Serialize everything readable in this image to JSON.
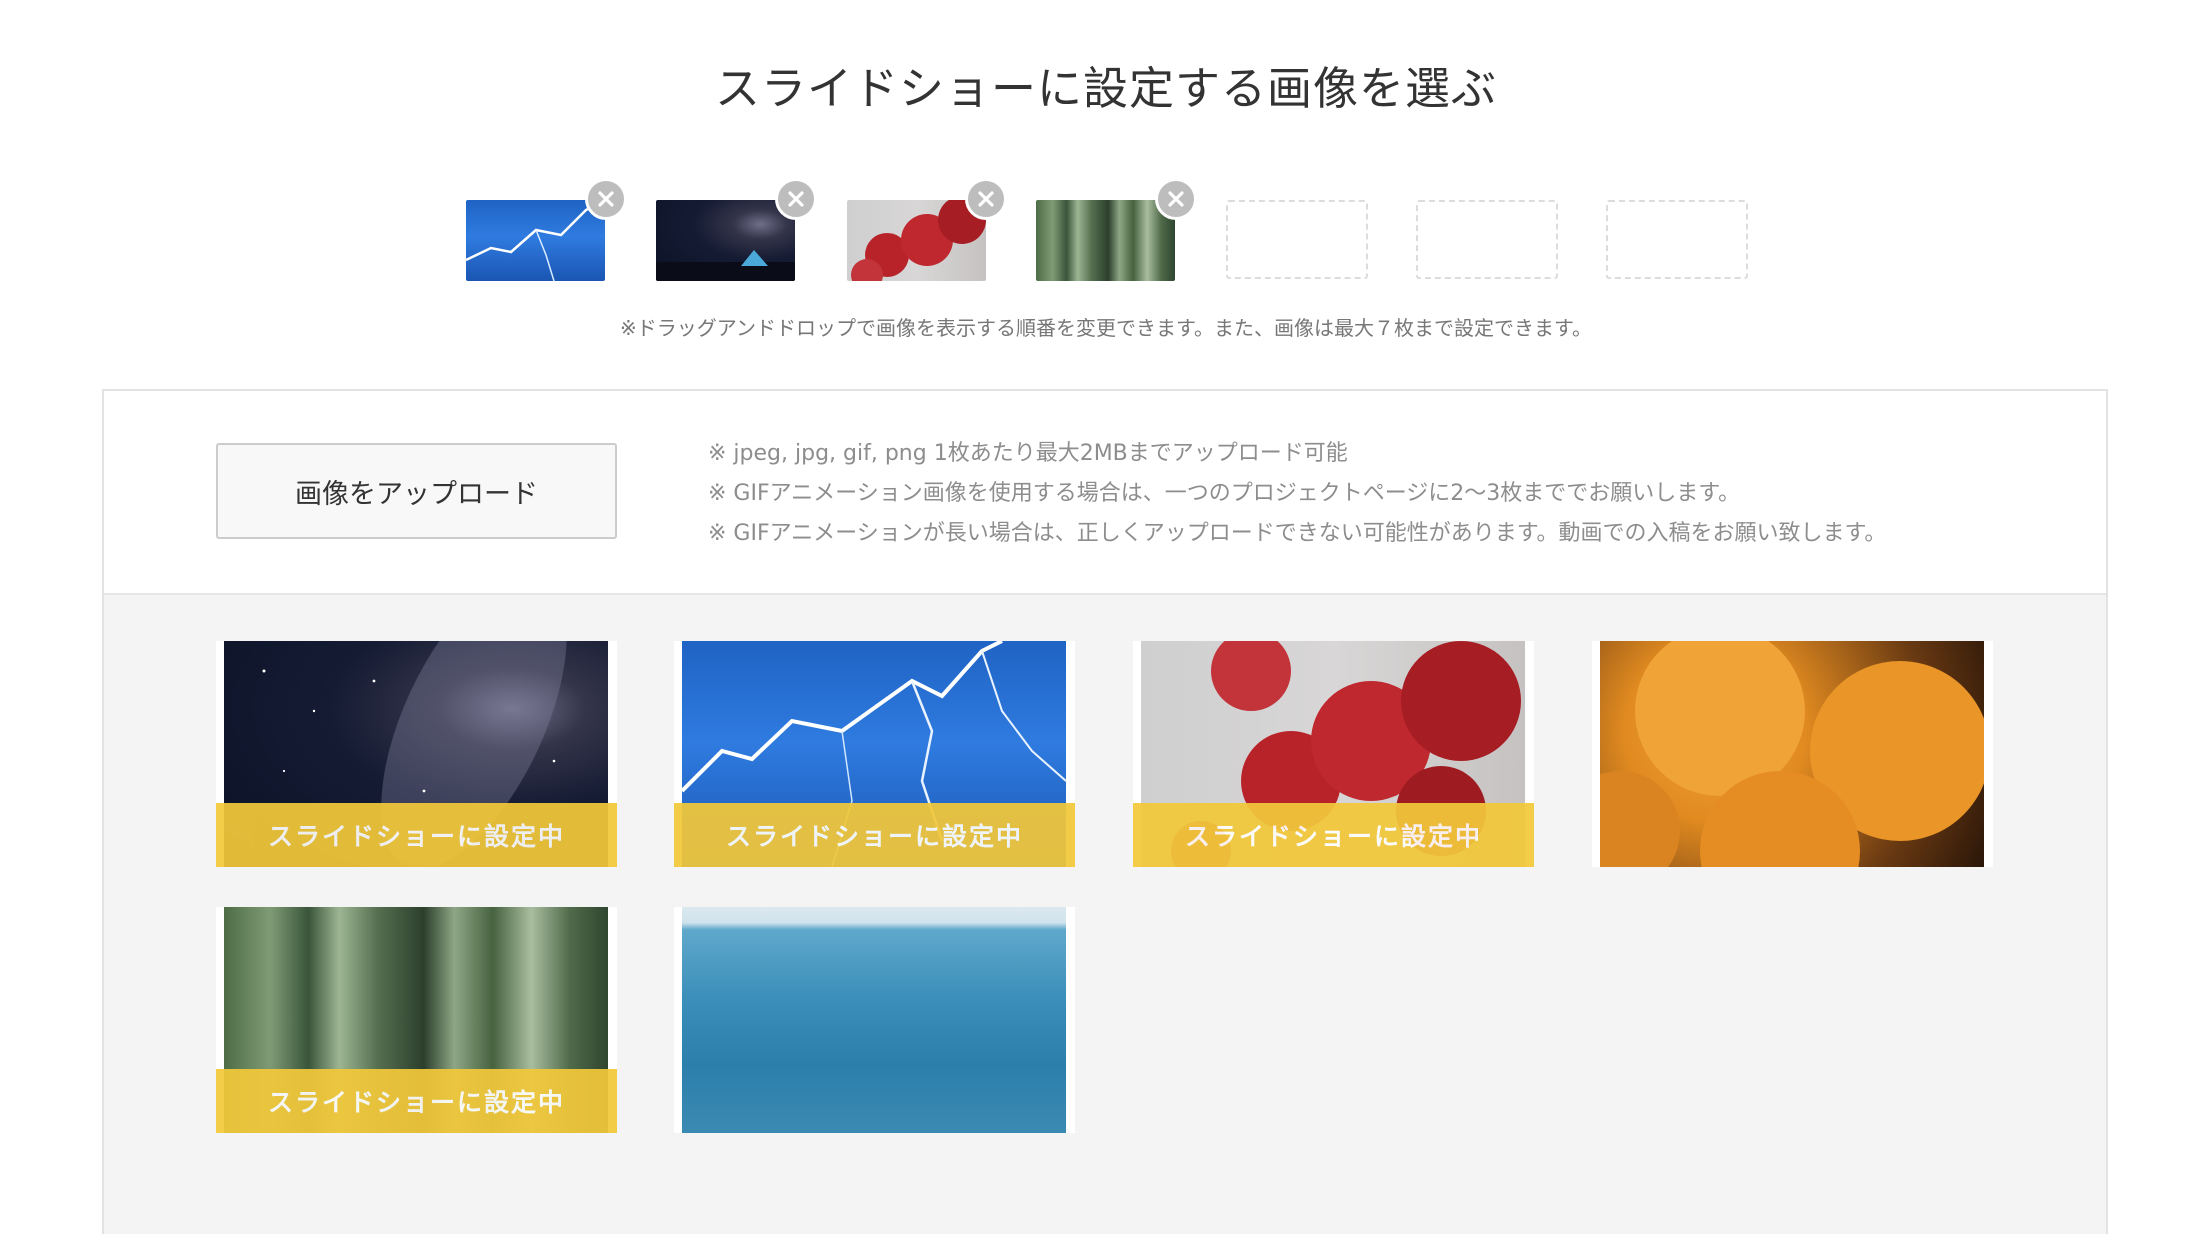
{
  "header": {
    "title": "スライドショーに設定する画像を選ぶ"
  },
  "selected": {
    "images": [
      {
        "name": "lightning",
        "remove_icon": "close-icon"
      },
      {
        "name": "starry-tent",
        "remove_icon": "close-icon"
      },
      {
        "name": "red-maple",
        "remove_icon": "close-icon"
      },
      {
        "name": "bamboo",
        "remove_icon": "close-icon"
      }
    ],
    "empty_slots": 3,
    "note": "※ドラッグアンドドロップで画像を表示する順番を変更できます。また、画像は最大７枚まで設定できます。"
  },
  "upload": {
    "button_label": "画像をアップロード",
    "notes": [
      "※ jpeg, jpg, gif, png 1枚あたり最大2MBまでアップロード可能",
      "※ GIFアニメーション画像を使用する場合は、一つのプロジェクトページに2〜3枚まででお願いします。",
      "※ GIFアニメーションが長い場合は、正しくアップロードできない可能性があります。動画での入稿をお願い致します。"
    ]
  },
  "gallery": {
    "badge_label": "スライドショーに設定中",
    "items": [
      {
        "image": "milky-way",
        "in_slideshow": true
      },
      {
        "image": "lightning",
        "in_slideshow": true
      },
      {
        "image": "red-maple",
        "in_slideshow": true
      },
      {
        "image": "oranges",
        "in_slideshow": false
      },
      {
        "image": "bamboo",
        "in_slideshow": true
      },
      {
        "image": "sea",
        "in_slideshow": false
      }
    ]
  },
  "colors": {
    "badge": "#f2c83a",
    "panel_bg": "#f4f4f4",
    "remove_button": "#bdbdbd"
  }
}
